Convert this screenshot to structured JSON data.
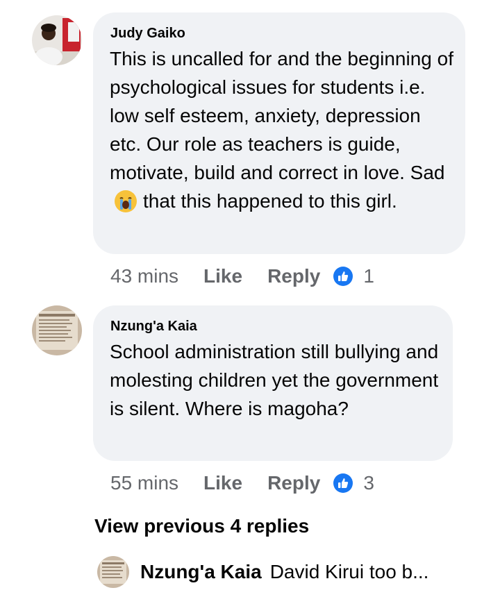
{
  "comments": [
    {
      "author": "Judy Gaiko",
      "text_before_emoji": "This is uncalled for and the beginning of psychological issues for students i.e. low self esteem, anxiety, depression etc. Our role as teachers is guide, motivate, build and correct in love. Sad",
      "emoji": "crying-face",
      "text_after_emoji": "that this happened to this girl.",
      "time": "43 mins",
      "like_label": "Like",
      "reply_label": "Reply",
      "reaction_icon": "like-icon",
      "reaction_count": "1"
    },
    {
      "author": "Nzung'a Kaia",
      "text": "School administration still bullying and molesting children yet the government is silent. Where is magoha?",
      "time": "55 mins",
      "like_label": "Like",
      "reply_label": "Reply",
      "reaction_icon": "like-icon",
      "reaction_count": "3"
    }
  ],
  "view_previous_replies": "View previous 4 replies",
  "latest_reply": {
    "author": "Nzung'a Kaia",
    "snippet": "David Kirui too b..."
  },
  "colors": {
    "bubble": "#f0f2f5",
    "text": "#050505",
    "secondary": "#65676b",
    "like_blue": "#1877f2"
  }
}
